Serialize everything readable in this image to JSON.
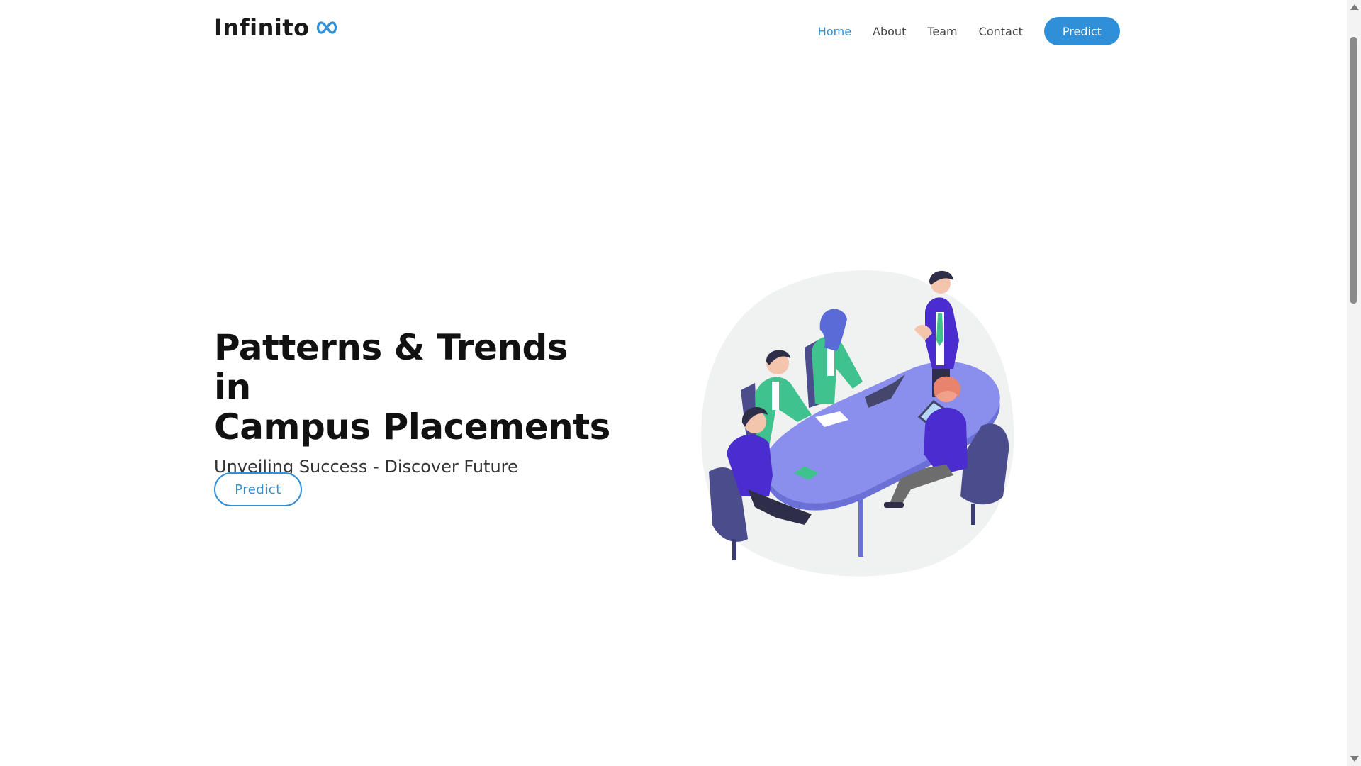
{
  "brand": {
    "name": "Infinito",
    "icon": "infinity-icon",
    "icon_color": "#2f8fd8"
  },
  "nav": {
    "items": [
      {
        "label": "Home",
        "active": true
      },
      {
        "label": "About",
        "active": false
      },
      {
        "label": "Team",
        "active": false
      },
      {
        "label": "Contact",
        "active": false
      }
    ],
    "cta_label": "Predict"
  },
  "hero": {
    "title_line1": "Patterns & Trends in",
    "title_line2": "Campus Placements",
    "subtitle": "Unveiling Success - Discover Future",
    "button_label": "Predict"
  },
  "illustration": {
    "icon": "team-meeting-illustration"
  },
  "colors": {
    "accent": "#2f8fd8",
    "text": "#111111",
    "background": "#ffffff"
  }
}
